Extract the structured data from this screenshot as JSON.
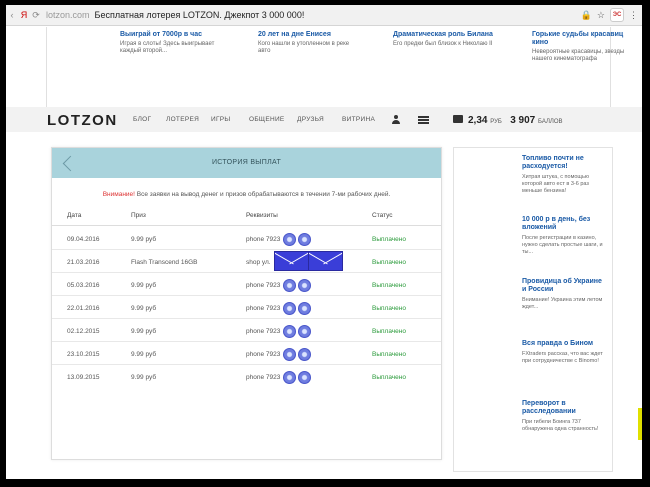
{
  "browser": {
    "back_glyph": "‹",
    "reload_glyph": "⟳",
    "ya_glyph": "Я",
    "domain": "lotzon.com",
    "title": "Бесплатная лотерея LOTZON. Джекпот 3 000 000!",
    "ext_label": "ЭС"
  },
  "teasers": [
    {
      "title": "Выиграй от 7000р в час",
      "text": "Играя в слоты! Здесь выигрывает каждый второй..."
    },
    {
      "title": "20 лет на дне Енисея",
      "text": "Кого нашли в утопленном в реке авто"
    },
    {
      "title": "Драматическая роль Билана",
      "text": "Его предки был близок к Николаю II"
    },
    {
      "title": "Горькие судьбы красавиц кино",
      "text": "Невероятные красавицы, звезды нашего кинематографа"
    }
  ],
  "nav": {
    "logo": "LOTZON",
    "items": [
      "БЛОГ",
      "ЛОТЕРЕЯ",
      "ИГРЫ",
      "ОБЩЕНИЕ",
      "ДРУЗЬЯ",
      "ВИТРИНА"
    ],
    "balance_value": "2,34",
    "balance_unit": "РУБ",
    "points_value": "3 907",
    "points_unit": "БАЛЛОВ"
  },
  "payouts": {
    "title": "ИСТОРИЯ ВЫПЛАТ",
    "warning_prefix": "Внимание!",
    "warning_text": " Все заявки на вывод денег и призов обрабатываются в течении 7-ми рабочих дней.",
    "columns": [
      "Дата",
      "Приз",
      "Реквизиты",
      "Статус"
    ],
    "rows": [
      {
        "date": "09.04.2016",
        "prize": "9.99 руб",
        "details": "phone 7923",
        "status": "Выплачено"
      },
      {
        "date": "21.03.2016",
        "prize": "Flash Transcend 16GB",
        "details": "shop ул.",
        "status": "Выплачено"
      },
      {
        "date": "05.03.2016",
        "prize": "9.99 руб",
        "details": "phone 7923",
        "status": "Выплачено"
      },
      {
        "date": "22.01.2016",
        "prize": "9.99 руб",
        "details": "phone 7923",
        "status": "Выплачено"
      },
      {
        "date": "02.12.2015",
        "prize": "9.99 руб",
        "details": "phone 7923",
        "status": "Выплачено"
      },
      {
        "date": "23.10.2015",
        "prize": "9.99 руб",
        "details": "phone 7923",
        "status": "Выплачено"
      },
      {
        "date": "13.09.2015",
        "prize": "9.99 руб",
        "details": "phone 7923",
        "status": "Выплачено"
      }
    ]
  },
  "sidebar": [
    {
      "title": "Топливо почти не расходуется!",
      "text": "Хитрая штука, с помощью которой авто ест в 3-6 раз меньше бензина!"
    },
    {
      "title": "10 000 р в день, без вложений",
      "text": "После регистрации в казино, нужно сделать простые шаги, и ты..."
    },
    {
      "title": "Провидица об Украине и России",
      "text": "Внимание! Украина этим летом ждет..."
    },
    {
      "title": "Вся правда о Бином",
      "text": "FXtraders рассказ, что вас ждет при сотрудничестве с Binomo!"
    },
    {
      "title": "Переворот в расследовании",
      "text": "При гибели Боинга 737 обнаружена одна странность!"
    }
  ],
  "colors": {
    "accent_link": "#1a5aa6",
    "header_band": "#a9d3dc",
    "status_green": "#2a9a3a",
    "warning_red": "#d33333"
  }
}
